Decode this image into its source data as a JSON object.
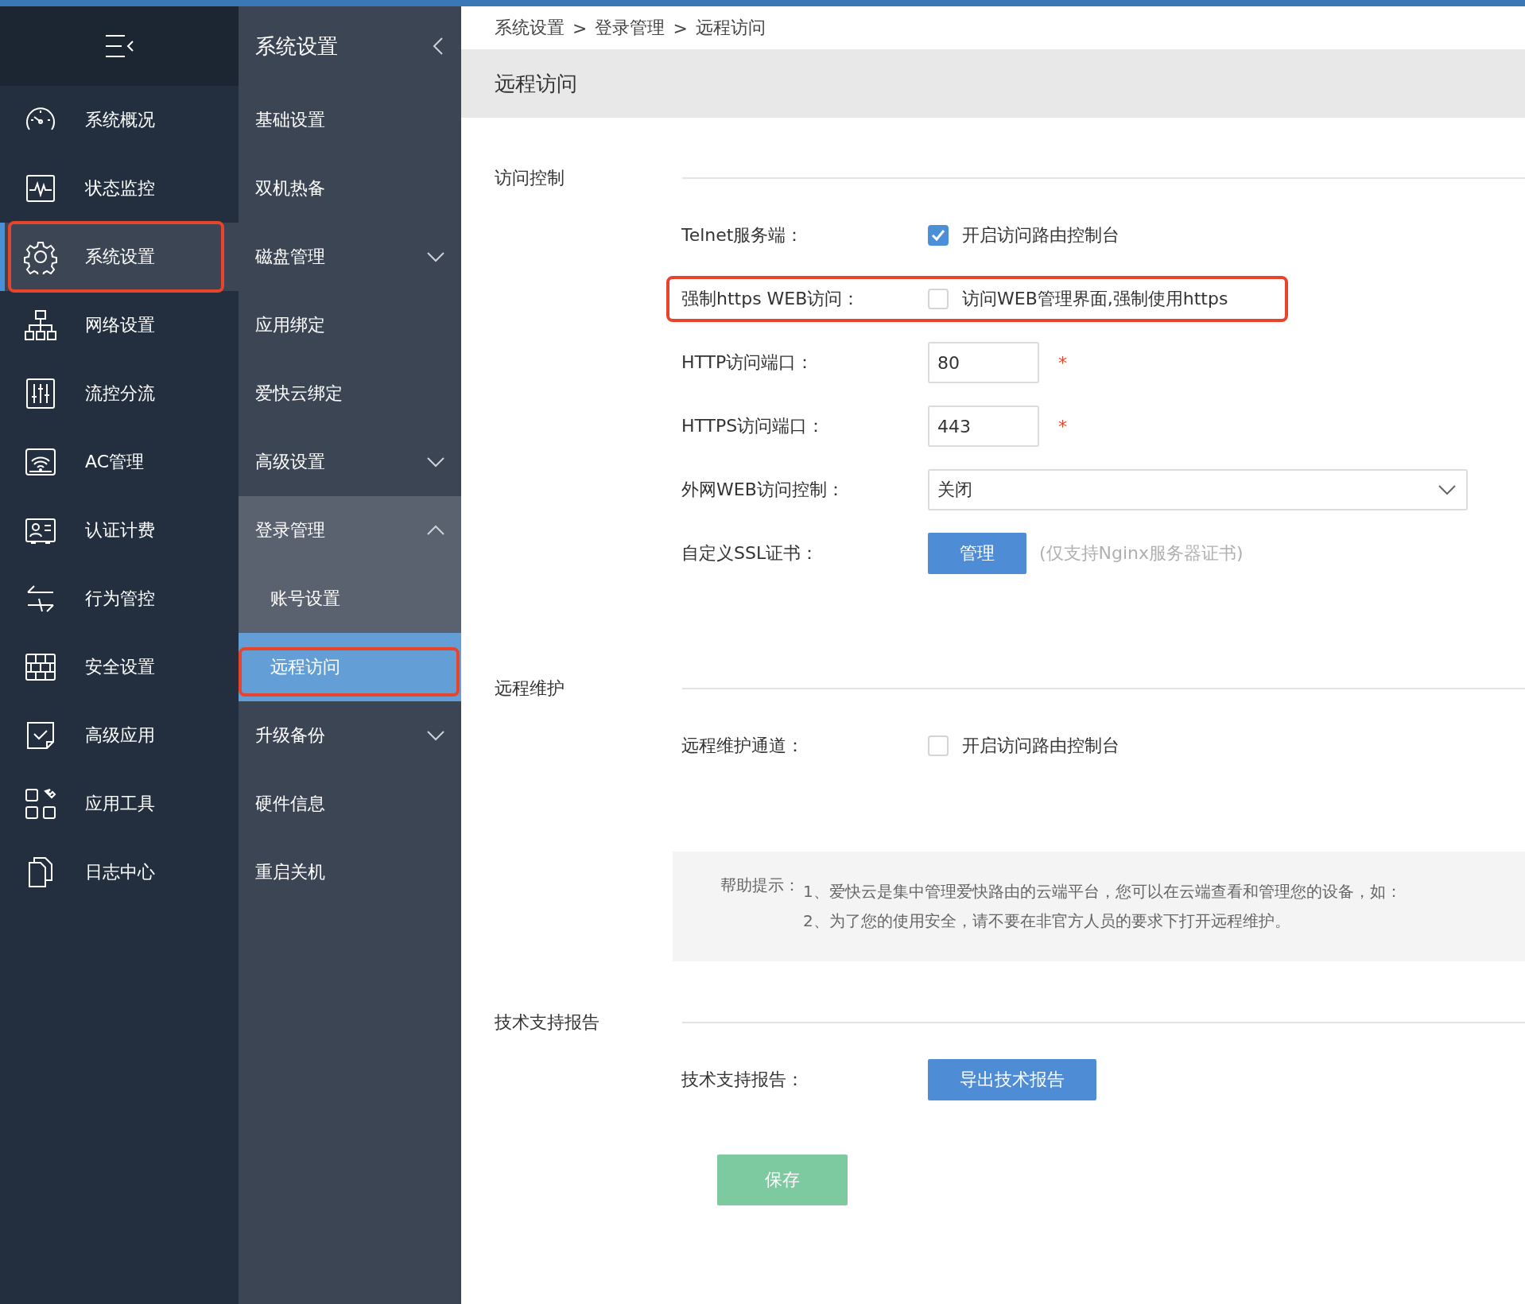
{
  "main_nav": {
    "items": [
      {
        "label": "系统概况",
        "selected": false,
        "highlighted": false
      },
      {
        "label": "状态监控",
        "selected": false,
        "highlighted": false
      },
      {
        "label": "系统设置",
        "selected": true,
        "highlighted": true
      },
      {
        "label": "网络设置",
        "selected": false,
        "highlighted": false
      },
      {
        "label": "流控分流",
        "selected": false,
        "highlighted": false
      },
      {
        "label": "AC管理",
        "selected": false,
        "highlighted": false
      },
      {
        "label": "认证计费",
        "selected": false,
        "highlighted": false
      },
      {
        "label": "行为管控",
        "selected": false,
        "highlighted": false
      },
      {
        "label": "安全设置",
        "selected": false,
        "highlighted": false
      },
      {
        "label": "高级应用",
        "selected": false,
        "highlighted": false
      },
      {
        "label": "应用工具",
        "selected": false,
        "highlighted": false
      },
      {
        "label": "日志中心",
        "selected": false,
        "highlighted": false
      }
    ]
  },
  "sub_nav": {
    "title": "系统设置",
    "items": [
      {
        "kind": "item",
        "label": "基础设置"
      },
      {
        "kind": "item",
        "label": "双机热备"
      },
      {
        "kind": "group",
        "label": "磁盘管理",
        "expanded": false
      },
      {
        "kind": "item",
        "label": "应用绑定"
      },
      {
        "kind": "item",
        "label": "爱快云绑定"
      },
      {
        "kind": "group",
        "label": "高级设置",
        "expanded": false
      },
      {
        "kind": "group",
        "label": "登录管理",
        "expanded": true,
        "children": [
          {
            "label": "账号设置",
            "selected": false,
            "highlighted": false
          },
          {
            "label": "远程访问",
            "selected": true,
            "highlighted": true
          }
        ]
      },
      {
        "kind": "group",
        "label": "升级备份",
        "expanded": false
      },
      {
        "kind": "item",
        "label": "硬件信息"
      },
      {
        "kind": "item",
        "label": "重启关机"
      }
    ]
  },
  "breadcrumb": [
    "系统设置",
    ">",
    "登录管理",
    ">",
    "远程访问"
  ],
  "page_title": "远程访问",
  "sections": [
    {
      "title": "访问控制",
      "rows": [
        {
          "kind": "checkbox",
          "label": "Telnet服务端：",
          "checked": true,
          "text": "开启访问路由控制台",
          "highlighted": false
        },
        {
          "kind": "checkbox",
          "label": "强制https WEB访问：",
          "checked": false,
          "text": "访问WEB管理界面,强制使用https",
          "highlighted": true
        },
        {
          "kind": "input",
          "label": "HTTP访问端口：",
          "value": "80",
          "required_mark": "*"
        },
        {
          "kind": "input",
          "label": "HTTPS访问端口：",
          "value": "443",
          "required_mark": "*"
        },
        {
          "kind": "select",
          "label": "外网WEB访问控制：",
          "value": "关闭"
        },
        {
          "kind": "button",
          "label": "自定义SSL证书：",
          "button": "管理",
          "note": "(仅支持Nginx服务器证书)"
        }
      ]
    },
    {
      "title": "远程维护",
      "rows": [
        {
          "kind": "checkbox",
          "label": "远程维护通道：",
          "checked": false,
          "text": "开启访问路由控制台",
          "highlighted": false
        }
      ],
      "help": {
        "label": "帮助提示：",
        "lines": [
          "1、爱快云是集中管理爱快路由的云端平台，您可以在云端查看和管理您的设备，如：",
          "2、为了您的使用安全，请不要在非官方人员的要求下打开远程维护。"
        ]
      }
    },
    {
      "title": "技术支持报告",
      "rows": [
        {
          "kind": "button",
          "label": "技术支持报告：",
          "button": "导出技术报告"
        }
      ]
    }
  ],
  "save_button": "保存"
}
